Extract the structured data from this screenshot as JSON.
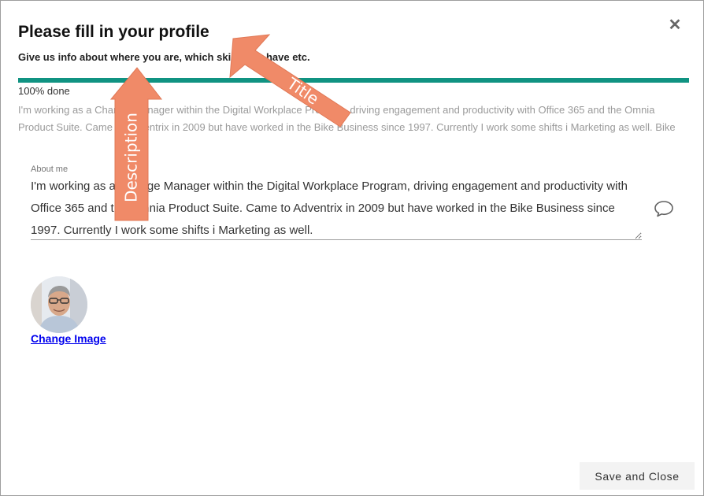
{
  "dialog": {
    "title": "Please fill in your profile",
    "subtitle": "Give us info about where you are, which skills you have etc.",
    "close_icon": "close-icon"
  },
  "progress": {
    "label": "100% done",
    "value": 1.0,
    "color": "#109382"
  },
  "profile": {
    "description": "I'm working as a Change Manager within the Digital Workplace Program, driving engagement and productivity with Office 365 and the Omnia Product Suite. Came to Adventrix in 2009 but have worked in the Bike Business since 1997. Currently I work some shifts i Marketing as well. Bike",
    "about_label": "About me",
    "about_value": "I'm working as a Change Manager within the Digital Workplace Program, driving engagement and productivity with Office 365 and the Omnia Product Suite. Came to Adventrix in 2009 but have worked in the Bike Business since 1997. Currently I work some shifts i Marketing as well.",
    "comment_icon": "comment-icon",
    "change_image_label": "Change Image"
  },
  "footer": {
    "save_label": "Save and Close"
  },
  "annotations": {
    "title_label": "Title",
    "description_label": "Description",
    "color": "#f08a68"
  }
}
